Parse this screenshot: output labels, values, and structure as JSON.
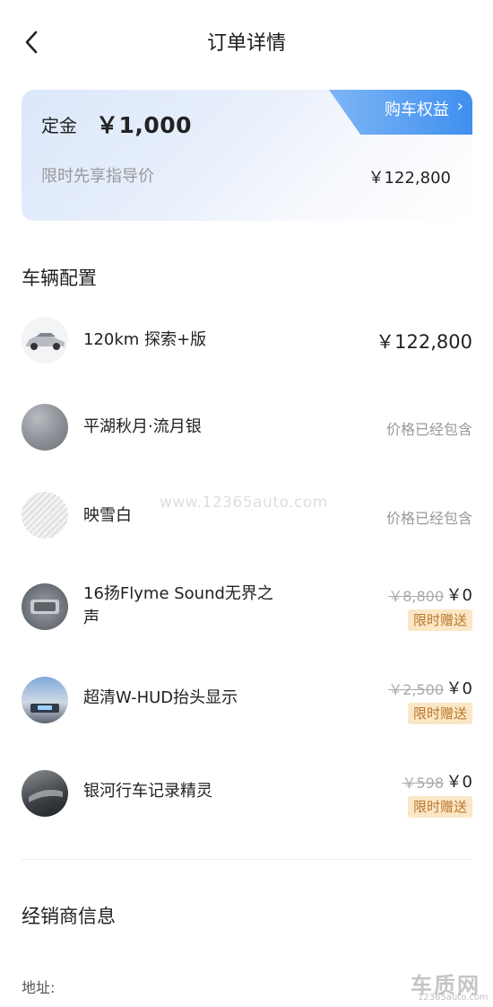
{
  "header": {
    "title": "订单详情",
    "back_icon": "chevron-left-icon"
  },
  "summary_card": {
    "deposit_label": "定金",
    "deposit_value": "￥1,000",
    "benefit_button": "购车权益",
    "benefit_icon": "chevron-right-icon",
    "guide_label": "限时先享指导价",
    "guide_price": "￥122,800",
    "accent_color": "#3f8ff0"
  },
  "vehicle_config": {
    "title": "车辆配置",
    "items": [
      {
        "name": "120km 探索+版",
        "price": "￥122,800",
        "thumb": "car-silhouette"
      },
      {
        "name": "平湖秋月·流月银",
        "note": "价格已经包含",
        "thumb": "silver-paint-swatch"
      },
      {
        "name": "映雪白",
        "note": "价格已经包含",
        "thumb": "white-interior-swatch"
      },
      {
        "name_line1": "16扬Flyme Sound无界之",
        "name_line2": "声",
        "original_price": "￥8,800",
        "price": "￥0",
        "badge": "限时赠送",
        "thumb": "speaker-interior"
      },
      {
        "name": "超清W-HUD抬头显示",
        "original_price": "￥2,500",
        "price": "￥0",
        "badge": "限时赠送",
        "thumb": "hud-display"
      },
      {
        "name": "银河行车记录精灵",
        "original_price": "￥598",
        "price": "￥0",
        "badge": "限时赠送",
        "thumb": "dashcam"
      }
    ]
  },
  "dealer": {
    "title": "经销商信息",
    "address_label": "地址:"
  },
  "watermark": {
    "url": "www.12365auto.com",
    "logo": "车质网",
    "logo_sub": "12365auto.com"
  }
}
